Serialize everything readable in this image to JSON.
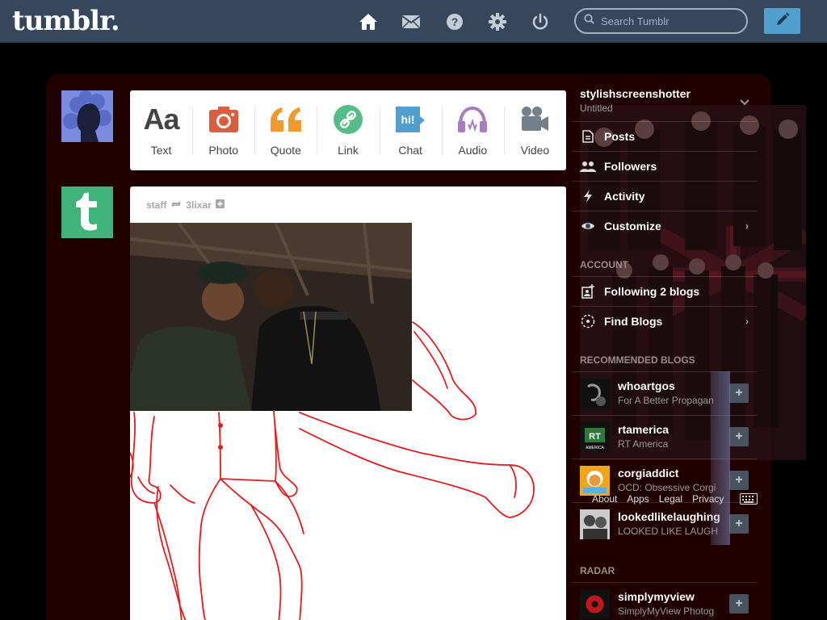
{
  "header": {
    "logo": "tumblr.",
    "search_placeholder": "Search Tumblr",
    "nav_icons": [
      "home-icon",
      "mail-icon",
      "help-icon",
      "gear-icon",
      "power-icon"
    ],
    "compose_icon": "pencil-icon"
  },
  "post_form": {
    "items": [
      {
        "label": "Text",
        "icon": "text-icon",
        "color": "#444444"
      },
      {
        "label": "Photo",
        "icon": "camera-icon",
        "color": "#d95e40"
      },
      {
        "label": "Quote",
        "icon": "quote-icon",
        "color": "#f2992e"
      },
      {
        "label": "Link",
        "icon": "link-icon",
        "color": "#56bc8a"
      },
      {
        "label": "Chat",
        "icon": "chat-icon",
        "color": "#529ecc"
      },
      {
        "label": "Audio",
        "icon": "headphones-icon",
        "color": "#a77dc2"
      },
      {
        "label": "Video",
        "icon": "video-camera-icon",
        "color": "#748089"
      }
    ]
  },
  "post": {
    "author": "staff",
    "reblogged_from": "3lixar",
    "reblog_icon": "reblog-icon",
    "follow_icon": "plus-icon"
  },
  "sidebar": {
    "blog_name": "stylishscreenshotter",
    "blog_title": "Untitled",
    "blog_items": [
      {
        "label": "Posts",
        "icon": "posts-icon"
      },
      {
        "label": "Followers",
        "icon": "followers-icon"
      },
      {
        "label": "Activity",
        "icon": "lightning-icon"
      },
      {
        "label": "Customize",
        "icon": "eye-icon"
      }
    ],
    "account_heading": "ACCOUNT",
    "account_items": [
      {
        "label": "Following 2 blogs",
        "icon": "following-icon"
      },
      {
        "label": "Find Blogs",
        "icon": "compass-icon"
      }
    ],
    "recommended_heading": "RECOMMENDED BLOGS",
    "recommended": [
      {
        "name": "whoartgos",
        "desc": "For A Better Propagan"
      },
      {
        "name": "rtamerica",
        "desc": "RT America"
      },
      {
        "name": "corgiaddict",
        "desc": "OCD: Obsessive Corgi"
      },
      {
        "name": "lookedlikelaughing",
        "desc": "LOOKED LIKE LAUGH"
      }
    ],
    "footer_links": [
      "About",
      "Apps",
      "Legal",
      "Privacy"
    ],
    "radar_heading": "RADAR",
    "radar": {
      "name": "simplymyview",
      "desc": "SimplyMyView Photog"
    },
    "colors": {
      "accent": "#529ecc",
      "header": "#36465d",
      "frame": "#210000"
    }
  }
}
